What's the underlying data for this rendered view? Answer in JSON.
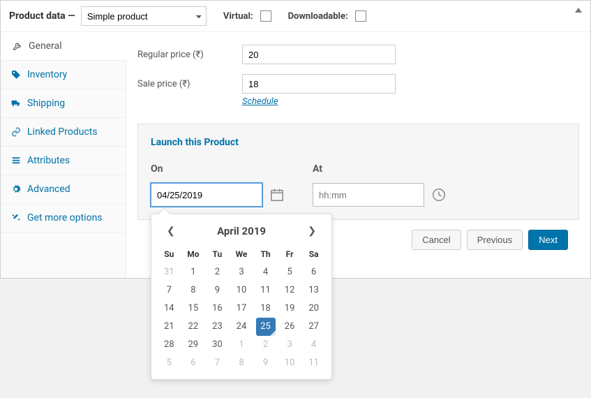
{
  "header": {
    "title": "Product data —",
    "product_type": "Simple product",
    "virtual_label": "Virtual:",
    "downloadable_label": "Downloadable:"
  },
  "sidebar": {
    "items": [
      {
        "label": "General",
        "icon": "wrench"
      },
      {
        "label": "Inventory",
        "icon": "tag"
      },
      {
        "label": "Shipping",
        "icon": "truck"
      },
      {
        "label": "Linked Products",
        "icon": "link"
      },
      {
        "label": "Attributes",
        "icon": "list"
      },
      {
        "label": "Advanced",
        "icon": "gear"
      },
      {
        "label": "Get more options",
        "icon": "magic"
      }
    ]
  },
  "form": {
    "regular_price_label": "Regular price (₹)",
    "regular_price_value": "20",
    "sale_price_label": "Sale price (₹)",
    "sale_price_value": "18",
    "schedule_link": "Schedule"
  },
  "launch": {
    "title": "Launch this Product",
    "on_label": "On",
    "on_value": "04/25/2019",
    "at_label": "At",
    "at_placeholder": "hh:mm"
  },
  "buttons": {
    "cancel": "Cancel",
    "previous": "Previous",
    "next": "Next"
  },
  "datepicker": {
    "title": "April 2019",
    "weekdays": [
      "Su",
      "Mo",
      "Tu",
      "We",
      "Th",
      "Fr",
      "Sa"
    ],
    "weeks": [
      [
        {
          "d": "31",
          "o": true
        },
        {
          "d": "1"
        },
        {
          "d": "2"
        },
        {
          "d": "3"
        },
        {
          "d": "4"
        },
        {
          "d": "5"
        },
        {
          "d": "6"
        }
      ],
      [
        {
          "d": "7"
        },
        {
          "d": "8"
        },
        {
          "d": "9"
        },
        {
          "d": "10"
        },
        {
          "d": "11"
        },
        {
          "d": "12"
        },
        {
          "d": "13"
        }
      ],
      [
        {
          "d": "14"
        },
        {
          "d": "15"
        },
        {
          "d": "16"
        },
        {
          "d": "17"
        },
        {
          "d": "18"
        },
        {
          "d": "19"
        },
        {
          "d": "20"
        }
      ],
      [
        {
          "d": "21"
        },
        {
          "d": "22"
        },
        {
          "d": "23"
        },
        {
          "d": "24"
        },
        {
          "d": "25",
          "sel": true
        },
        {
          "d": "26"
        },
        {
          "d": "27"
        }
      ],
      [
        {
          "d": "28"
        },
        {
          "d": "29"
        },
        {
          "d": "30"
        },
        {
          "d": "1",
          "o": true
        },
        {
          "d": "2",
          "o": true
        },
        {
          "d": "3",
          "o": true
        },
        {
          "d": "4",
          "o": true
        }
      ],
      [
        {
          "d": "5",
          "o": true
        },
        {
          "d": "6",
          "o": true
        },
        {
          "d": "7",
          "o": true
        },
        {
          "d": "8",
          "o": true
        },
        {
          "d": "9",
          "o": true
        },
        {
          "d": "10",
          "o": true
        },
        {
          "d": "11",
          "o": true
        }
      ]
    ]
  }
}
